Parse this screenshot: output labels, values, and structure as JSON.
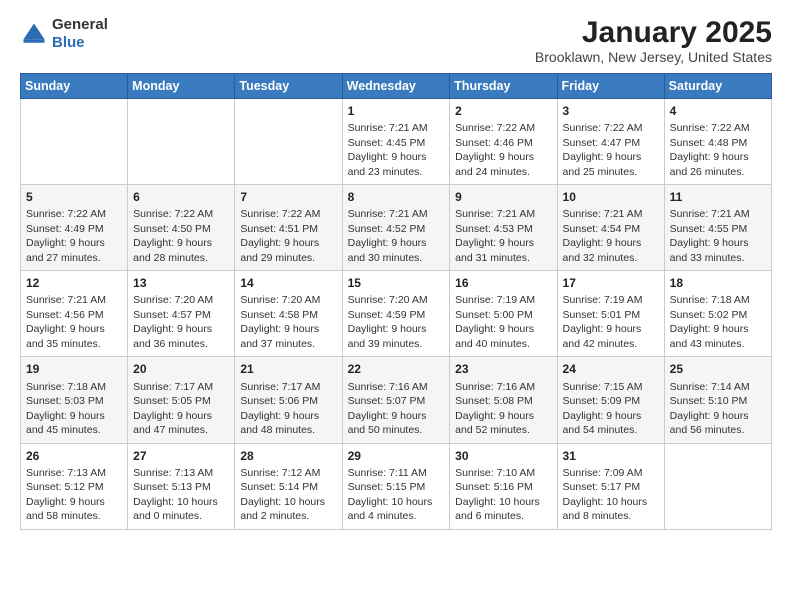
{
  "header": {
    "logo_general": "General",
    "logo_blue": "Blue",
    "month_title": "January 2025",
    "location": "Brooklawn, New Jersey, United States"
  },
  "days_of_week": [
    "Sunday",
    "Monday",
    "Tuesday",
    "Wednesday",
    "Thursday",
    "Friday",
    "Saturday"
  ],
  "weeks": [
    [
      {
        "day": "",
        "info": ""
      },
      {
        "day": "",
        "info": ""
      },
      {
        "day": "",
        "info": ""
      },
      {
        "day": "1",
        "info": "Sunrise: 7:21 AM\nSunset: 4:45 PM\nDaylight: 9 hours\nand 23 minutes."
      },
      {
        "day": "2",
        "info": "Sunrise: 7:22 AM\nSunset: 4:46 PM\nDaylight: 9 hours\nand 24 minutes."
      },
      {
        "day": "3",
        "info": "Sunrise: 7:22 AM\nSunset: 4:47 PM\nDaylight: 9 hours\nand 25 minutes."
      },
      {
        "day": "4",
        "info": "Sunrise: 7:22 AM\nSunset: 4:48 PM\nDaylight: 9 hours\nand 26 minutes."
      }
    ],
    [
      {
        "day": "5",
        "info": "Sunrise: 7:22 AM\nSunset: 4:49 PM\nDaylight: 9 hours\nand 27 minutes."
      },
      {
        "day": "6",
        "info": "Sunrise: 7:22 AM\nSunset: 4:50 PM\nDaylight: 9 hours\nand 28 minutes."
      },
      {
        "day": "7",
        "info": "Sunrise: 7:22 AM\nSunset: 4:51 PM\nDaylight: 9 hours\nand 29 minutes."
      },
      {
        "day": "8",
        "info": "Sunrise: 7:21 AM\nSunset: 4:52 PM\nDaylight: 9 hours\nand 30 minutes."
      },
      {
        "day": "9",
        "info": "Sunrise: 7:21 AM\nSunset: 4:53 PM\nDaylight: 9 hours\nand 31 minutes."
      },
      {
        "day": "10",
        "info": "Sunrise: 7:21 AM\nSunset: 4:54 PM\nDaylight: 9 hours\nand 32 minutes."
      },
      {
        "day": "11",
        "info": "Sunrise: 7:21 AM\nSunset: 4:55 PM\nDaylight: 9 hours\nand 33 minutes."
      }
    ],
    [
      {
        "day": "12",
        "info": "Sunrise: 7:21 AM\nSunset: 4:56 PM\nDaylight: 9 hours\nand 35 minutes."
      },
      {
        "day": "13",
        "info": "Sunrise: 7:20 AM\nSunset: 4:57 PM\nDaylight: 9 hours\nand 36 minutes."
      },
      {
        "day": "14",
        "info": "Sunrise: 7:20 AM\nSunset: 4:58 PM\nDaylight: 9 hours\nand 37 minutes."
      },
      {
        "day": "15",
        "info": "Sunrise: 7:20 AM\nSunset: 4:59 PM\nDaylight: 9 hours\nand 39 minutes."
      },
      {
        "day": "16",
        "info": "Sunrise: 7:19 AM\nSunset: 5:00 PM\nDaylight: 9 hours\nand 40 minutes."
      },
      {
        "day": "17",
        "info": "Sunrise: 7:19 AM\nSunset: 5:01 PM\nDaylight: 9 hours\nand 42 minutes."
      },
      {
        "day": "18",
        "info": "Sunrise: 7:18 AM\nSunset: 5:02 PM\nDaylight: 9 hours\nand 43 minutes."
      }
    ],
    [
      {
        "day": "19",
        "info": "Sunrise: 7:18 AM\nSunset: 5:03 PM\nDaylight: 9 hours\nand 45 minutes."
      },
      {
        "day": "20",
        "info": "Sunrise: 7:17 AM\nSunset: 5:05 PM\nDaylight: 9 hours\nand 47 minutes."
      },
      {
        "day": "21",
        "info": "Sunrise: 7:17 AM\nSunset: 5:06 PM\nDaylight: 9 hours\nand 48 minutes."
      },
      {
        "day": "22",
        "info": "Sunrise: 7:16 AM\nSunset: 5:07 PM\nDaylight: 9 hours\nand 50 minutes."
      },
      {
        "day": "23",
        "info": "Sunrise: 7:16 AM\nSunset: 5:08 PM\nDaylight: 9 hours\nand 52 minutes."
      },
      {
        "day": "24",
        "info": "Sunrise: 7:15 AM\nSunset: 5:09 PM\nDaylight: 9 hours\nand 54 minutes."
      },
      {
        "day": "25",
        "info": "Sunrise: 7:14 AM\nSunset: 5:10 PM\nDaylight: 9 hours\nand 56 minutes."
      }
    ],
    [
      {
        "day": "26",
        "info": "Sunrise: 7:13 AM\nSunset: 5:12 PM\nDaylight: 9 hours\nand 58 minutes."
      },
      {
        "day": "27",
        "info": "Sunrise: 7:13 AM\nSunset: 5:13 PM\nDaylight: 10 hours\nand 0 minutes."
      },
      {
        "day": "28",
        "info": "Sunrise: 7:12 AM\nSunset: 5:14 PM\nDaylight: 10 hours\nand 2 minutes."
      },
      {
        "day": "29",
        "info": "Sunrise: 7:11 AM\nSunset: 5:15 PM\nDaylight: 10 hours\nand 4 minutes."
      },
      {
        "day": "30",
        "info": "Sunrise: 7:10 AM\nSunset: 5:16 PM\nDaylight: 10 hours\nand 6 minutes."
      },
      {
        "day": "31",
        "info": "Sunrise: 7:09 AM\nSunset: 5:17 PM\nDaylight: 10 hours\nand 8 minutes."
      },
      {
        "day": "",
        "info": ""
      }
    ]
  ]
}
